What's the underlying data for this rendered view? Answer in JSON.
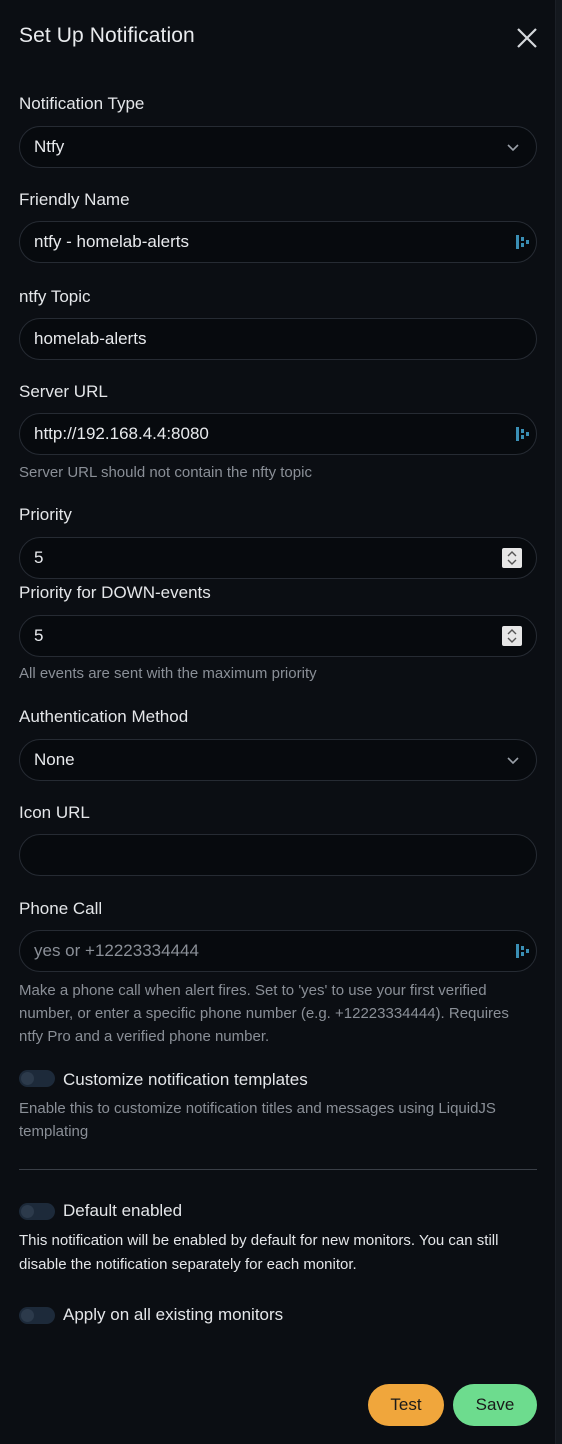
{
  "dialog": {
    "title": "Set Up Notification"
  },
  "fields": {
    "notification_type": {
      "label": "Notification Type",
      "value": "Ntfy"
    },
    "friendly_name": {
      "label": "Friendly Name",
      "value": "ntfy - homelab-alerts"
    },
    "ntfy_topic": {
      "label": "ntfy Topic",
      "value": "homelab-alerts"
    },
    "server_url": {
      "label": "Server URL",
      "value": "http://192.168.4.4:8080",
      "help": "Server URL should not contain the nfty topic"
    },
    "priority": {
      "label": "Priority",
      "value": "5"
    },
    "priority_down": {
      "label": "Priority for DOWN-events",
      "value": "5",
      "help": "All events are sent with the maximum priority"
    },
    "auth_method": {
      "label": "Authentication Method",
      "value": "None"
    },
    "icon_url": {
      "label": "Icon URL",
      "value": ""
    },
    "phone_call": {
      "label": "Phone Call",
      "placeholder": "yes or +12223334444",
      "help": "Make a phone call when alert fires. Set to 'yes' to use your first verified number, or enter a specific phone number (e.g. +12223334444). Requires ntfy Pro and a verified phone number."
    }
  },
  "toggles": {
    "customize_templates": {
      "label": "Customize notification templates",
      "help": "Enable this to customize notification titles and messages using LiquidJS templating",
      "on": false
    },
    "default_enabled": {
      "label": "Default enabled",
      "help": "This notification will be enabled by default for new monitors. You can still disable the notification separately for each monitor.",
      "on": false
    },
    "apply_existing": {
      "label": "Apply on all existing monitors",
      "on": false
    }
  },
  "buttons": {
    "test": "Test",
    "save": "Save"
  },
  "icons": {
    "close": "close-icon",
    "chevron": "chevron-down-icon",
    "password_manager": "keypass-icon",
    "spinner": "number-spinner-icon"
  },
  "colors": {
    "test_button": "#f0a63c",
    "save_button": "#6ddc8e",
    "background": "#0b0e13"
  }
}
